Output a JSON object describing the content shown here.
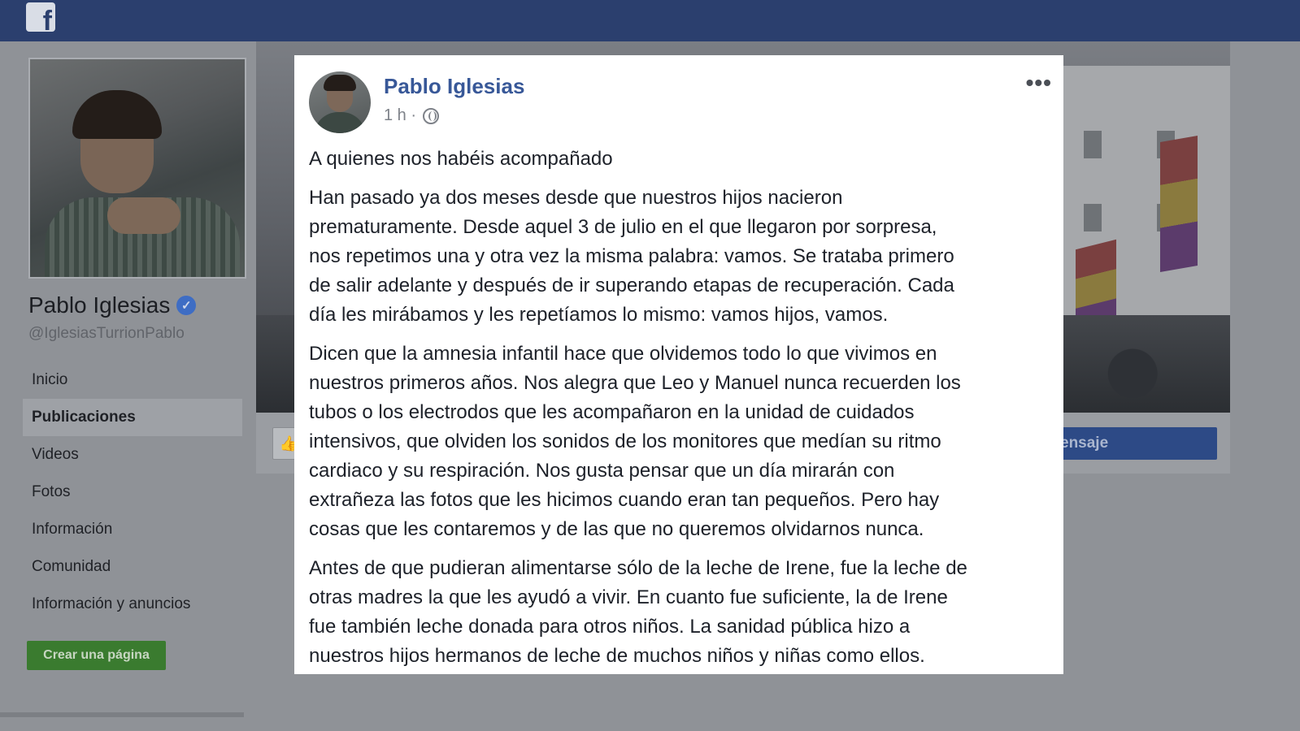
{
  "topbar": {
    "logo_letter": "f"
  },
  "sidebar": {
    "profile_name": "Pablo Iglesias",
    "verified_mark": "✓",
    "handle": "@IglesiasTurrionPablo",
    "nav": [
      {
        "label": "Inicio",
        "active": false
      },
      {
        "label": "Publicaciones",
        "active": true
      },
      {
        "label": "Videos",
        "active": false
      },
      {
        "label": "Fotos",
        "active": false
      },
      {
        "label": "Información",
        "active": false
      },
      {
        "label": "Comunidad",
        "active": false
      },
      {
        "label": "Información y anuncios",
        "active": false
      }
    ],
    "create_page_label": "Crear una página"
  },
  "cover_actions": {
    "like_icon": "👍",
    "message_label": "ensaje"
  },
  "post": {
    "author": "Pablo Iglesias",
    "time": "1 h ·",
    "more_icon": "•••",
    "paragraphs": [
      "A quienes nos habéis acompañado",
      "Han pasado ya dos meses desde que nuestros hijos nacieron\nprematuramente. Desde aquel 3 de julio en el que llegaron por sorpresa,\nnos repetimos una y otra vez la misma palabra: vamos. Se trataba primero\nde salir adelante y después de ir superando etapas de recuperación. Cada\ndía les mirábamos y les repetíamos lo mismo: vamos hijos, vamos.",
      "Dicen que la amnesia infantil hace que olvidemos todo lo que vivimos en\nnuestros primeros años. Nos alegra que Leo y Manuel nunca recuerden los\ntubos o los electrodos que les acompañaron en la unidad de cuidados\nintensivos, que olviden los sonidos de los monitores que medían su ritmo\ncardiaco y su respiración. Nos gusta pensar que un día mirarán con\nextrañeza las fotos que les hicimos cuando eran tan pequeños. Pero hay\ncosas que les contaremos y de las que no queremos olvidarnos nunca.",
      "Antes de que pudieran alimentarse sólo de la leche de Irene, fue la leche de\notras madres la que les ayudó a vivir. En cuanto fue suficiente, la de Irene\nfue también leche donada para otros niños. La sanidad pública hizo a\nnuestros hijos hermanos de leche de muchos niños y niñas como ellos."
    ]
  },
  "colors": {
    "topbar": "#2b3f6e",
    "author_link": "#385898",
    "create_button": "#3a7b2f",
    "message_button": "#2d4a86"
  }
}
